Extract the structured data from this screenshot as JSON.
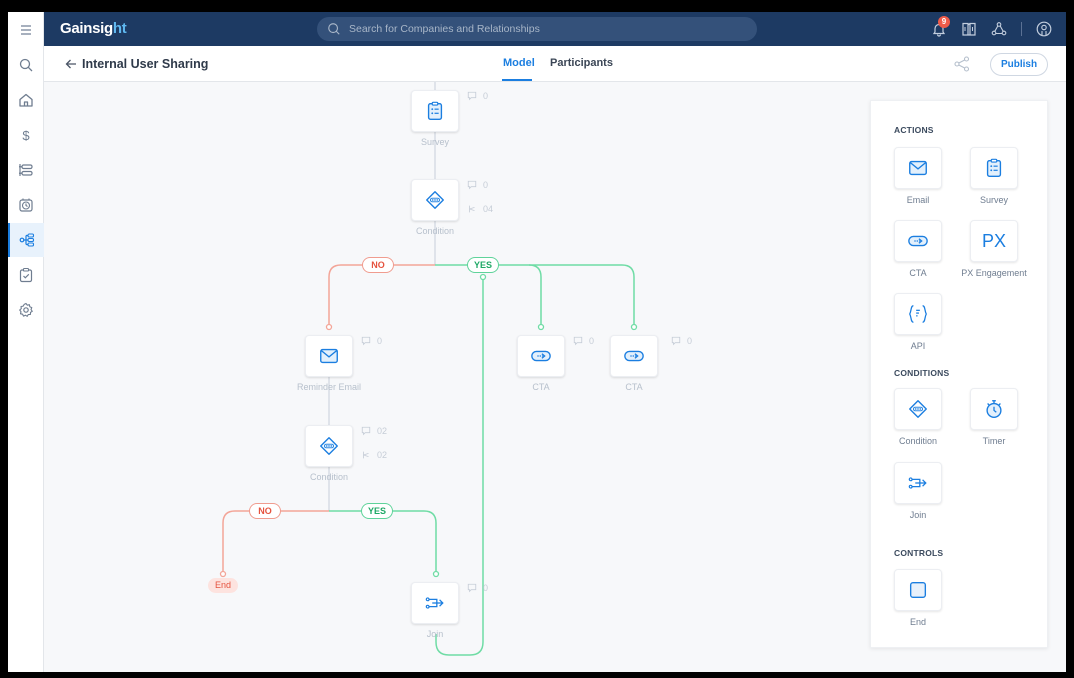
{
  "app": {
    "logo": {
      "main": "Gainsig",
      "accent": "ht"
    },
    "search": {
      "placeholder": "Search for Companies and Relationships"
    },
    "notifications": {
      "count": "9"
    },
    "colors": {
      "brand_navy": "#1d3a63",
      "accent_blue": "#1b7ee0",
      "yes_green": "#5fd39a",
      "no_red": "#f09c8f"
    }
  },
  "sidebar": {
    "items": [
      {
        "icon": "menu-icon"
      },
      {
        "icon": "search-icon"
      },
      {
        "icon": "home-icon"
      },
      {
        "icon": "dollar-icon"
      },
      {
        "icon": "timeline-icon"
      },
      {
        "icon": "timer-icon"
      },
      {
        "icon": "journey-orchestrator-icon",
        "active": true
      },
      {
        "icon": "clipboard-check-icon"
      },
      {
        "icon": "gear-icon"
      }
    ]
  },
  "subheader": {
    "title": "Internal User Sharing",
    "tabs": [
      {
        "label": "Model",
        "active": true
      },
      {
        "label": "Participants",
        "active": false
      }
    ],
    "publish_label": "Publish"
  },
  "flow": {
    "nodes": [
      {
        "id": "survey",
        "label": "Survey",
        "icon": "survey-icon",
        "comments": "0"
      },
      {
        "id": "condition1",
        "label": "Condition",
        "icon": "condition-icon",
        "comments": "0",
        "branches": "04"
      },
      {
        "id": "reminder",
        "label": "Reminder Email",
        "icon": "email-icon",
        "comments": "0"
      },
      {
        "id": "cta1",
        "label": "CTA",
        "icon": "cta-icon",
        "comments": "0"
      },
      {
        "id": "cta2",
        "label": "CTA",
        "icon": "cta-icon",
        "comments": "0"
      },
      {
        "id": "condition2",
        "label": "Condition",
        "icon": "condition-icon",
        "comments": "02",
        "branches": "02"
      },
      {
        "id": "join",
        "label": "Join",
        "icon": "join-icon",
        "comments": "0"
      }
    ],
    "branch_labels": {
      "no": "NO",
      "yes": "YES"
    },
    "end_label": "End"
  },
  "palette": {
    "sections": [
      {
        "title": "ACTIONS",
        "items": [
          {
            "label": "Email",
            "icon": "email-icon"
          },
          {
            "label": "Survey",
            "icon": "survey-icon"
          },
          {
            "label": "CTA",
            "icon": "cta-icon"
          },
          {
            "label": "PX Engagement",
            "icon": "px-icon",
            "glyph": "PX"
          },
          {
            "label": "API",
            "icon": "api-icon"
          }
        ]
      },
      {
        "title": "CONDITIONS",
        "items": [
          {
            "label": "Condition",
            "icon": "condition-icon"
          },
          {
            "label": "Timer",
            "icon": "timer-icon"
          },
          {
            "label": "Join",
            "icon": "join-icon"
          }
        ]
      },
      {
        "title": "CONTROLS",
        "items": [
          {
            "label": "End",
            "icon": "end-icon"
          }
        ]
      }
    ]
  }
}
